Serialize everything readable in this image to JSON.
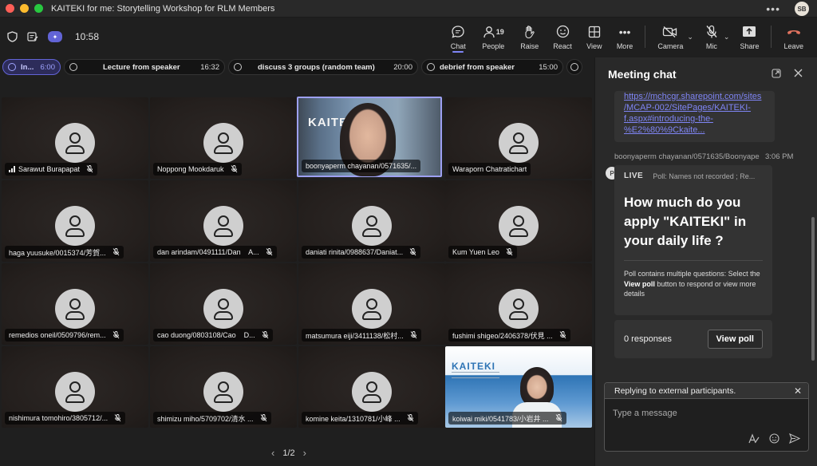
{
  "window": {
    "title": "KAITEKI for me: Storytelling Workshop for RLM Members",
    "menu": "•••",
    "user_initials": "SB"
  },
  "toolbar": {
    "time": "10:58",
    "buttons": {
      "chat": "Chat",
      "people": "People",
      "people_count": "19",
      "raise": "Raise",
      "react": "React",
      "view": "View",
      "more": "More",
      "camera": "Camera",
      "mic": "Mic",
      "share": "Share",
      "leave": "Leave"
    }
  },
  "agenda": [
    {
      "label": "In...",
      "duration": "6:00",
      "active": true
    },
    {
      "label": "Lecture from speaker",
      "duration": "16:32"
    },
    {
      "label": "discuss 3 groups (random team)",
      "duration": "20:00"
    },
    {
      "label": "debrief from speaker",
      "duration": "15:00"
    }
  ],
  "participants": [
    {
      "name": "Sarawut Burapapat"
    },
    {
      "name": "Noppong Mookdaruk"
    },
    {
      "name": "boonyaperm chayanan/0571635/..."
    },
    {
      "name": "Waraporn Chatratichart"
    },
    {
      "name": "haga yuusuke/0015374/芳賀..."
    },
    {
      "name": "dan arindam/0491111/Dan    A..."
    },
    {
      "name": "daniati rinita/0988637/Daniat..."
    },
    {
      "name": "Kum Yuen Leo"
    },
    {
      "name": "remedios oneil/0509796/rem..."
    },
    {
      "name": "cao duong/0803108/Cao    D..."
    },
    {
      "name": "matsumura eiji/3411138/松村..."
    },
    {
      "name": "fushimi shigeo/2406378/伏見 ..."
    },
    {
      "name": "nishimura tomohiro/3805712/..."
    },
    {
      "name": "shimizu miho/5709702/清水 ..."
    },
    {
      "name": "komine keita/1310781/小峰 ..."
    },
    {
      "name": "koiwai miki/0541783/小岩井 ..."
    }
  ],
  "video_overlays": {
    "kaiteki_top": "KAITEKI",
    "kaiteki_bottom": "KAITEKI"
  },
  "pager": {
    "label": "1/2"
  },
  "chat": {
    "title": "Meeting chat",
    "link_lines": [
      "https://mchcgr.sharepoint.com/sites",
      "/MCAP-002/SitePages/KAITEKI-",
      "f.aspx#introducing-the-",
      "%E2%80%9Ckaite..."
    ],
    "sender": "boonyaperm chayanan/0571635/Boonyape",
    "sent_time": "3:06 PM",
    "poll_avatar": "P",
    "poll": {
      "live": "LIVE",
      "meta": "Poll: Names not recorded ; Re...",
      "question": "How much do you apply \"KAITEKI\" in your daily life ?",
      "note_before": "Poll contains multiple questions: Select the ",
      "note_bold": "View poll",
      "note_after": " button to respond or view more details"
    },
    "responses": "0 responses",
    "view_poll": "View poll",
    "reply_banner": "Replying to external participants.",
    "input_placeholder": "Type a message"
  },
  "colors": {
    "accent": "#7f85f5",
    "leave": "#e1735f"
  }
}
